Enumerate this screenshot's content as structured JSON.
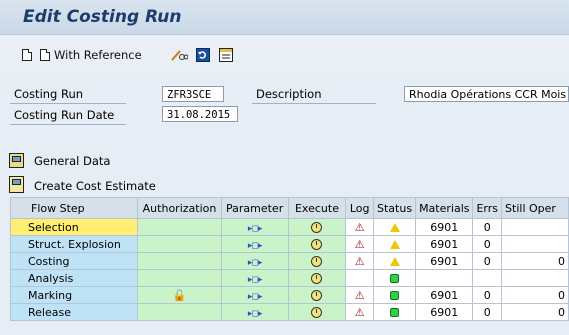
{
  "title": "Edit Costing Run",
  "toolbar": {
    "with_reference_label": "With Reference"
  },
  "form": {
    "costing_run_label": "Costing Run",
    "costing_run_value": "ZFR3SCE",
    "description_label": "Description",
    "description_value": "Rhodia Opérations CCR Mois",
    "costing_run_date_label": "Costing Run Date",
    "costing_run_date_value": "31.08.2015"
  },
  "sections": {
    "general_data": "General Data",
    "create_cost_estimate": "Create Cost Estimate"
  },
  "grid": {
    "headers": [
      "Flow Step",
      "Authorization",
      "Parameter",
      "Execute",
      "Log",
      "Status",
      "Materials",
      "Errs",
      "Still Oper"
    ],
    "rows": [
      {
        "step": "Selection",
        "auth": "",
        "log": true,
        "status": "warning",
        "materials": "6901",
        "errs": "0",
        "still": ""
      },
      {
        "step": "Struct. Explosion",
        "auth": "",
        "log": true,
        "status": "warning",
        "materials": "6901",
        "errs": "0",
        "still": ""
      },
      {
        "step": "Costing",
        "auth": "",
        "log": true,
        "status": "warning",
        "materials": "6901",
        "errs": "0",
        "still": "0"
      },
      {
        "step": "Analysis",
        "auth": "",
        "log": false,
        "status": "ok",
        "materials": "",
        "errs": "",
        "still": ""
      },
      {
        "step": "Marking",
        "auth": "lock",
        "log": true,
        "status": "ok",
        "materials": "6901",
        "errs": "0",
        "still": "0"
      },
      {
        "step": "Release",
        "auth": "",
        "log": true,
        "status": "ok",
        "materials": "6901",
        "errs": "0",
        "still": "0"
      }
    ]
  }
}
